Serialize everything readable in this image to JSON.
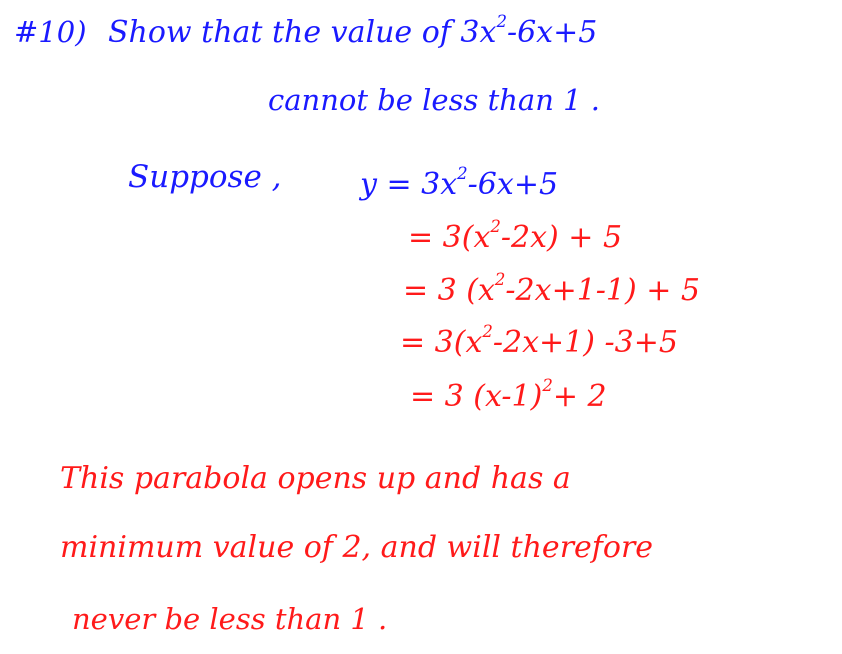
{
  "colors": {
    "problem_ink": "#1a1aff",
    "solution_ink": "#ff1a1a",
    "background": "#ffffff"
  },
  "problem": {
    "number": "#10)",
    "line_1_text": "Show that the value of ",
    "line_1_expr_a": "3x",
    "line_1_expr_exp": "2",
    "line_1_expr_b": "-6x+5",
    "line_2": "cannot be less than 1 ."
  },
  "work": {
    "suppose_label": "Suppose ,",
    "steps": [
      {
        "a": "y = 3x",
        "exp": "2",
        "b": "-6x+5"
      },
      {
        "a": "= 3(x",
        "exp": "2",
        "b": "-2x) + 5"
      },
      {
        "a": "= 3 (x",
        "exp": "2",
        "b": "-2x+1-1) + 5"
      },
      {
        "a": "= 3(x",
        "exp": "2",
        "b": "-2x+1) -3+5"
      },
      {
        "a": "= 3 (x-1)",
        "exp": "2",
        "b": "+ 2"
      }
    ]
  },
  "conclusion": {
    "line_1": "This parabola opens up and has a",
    "line_2": "minimum value of 2, and will therefore",
    "line_3": "never be less than 1 ."
  }
}
